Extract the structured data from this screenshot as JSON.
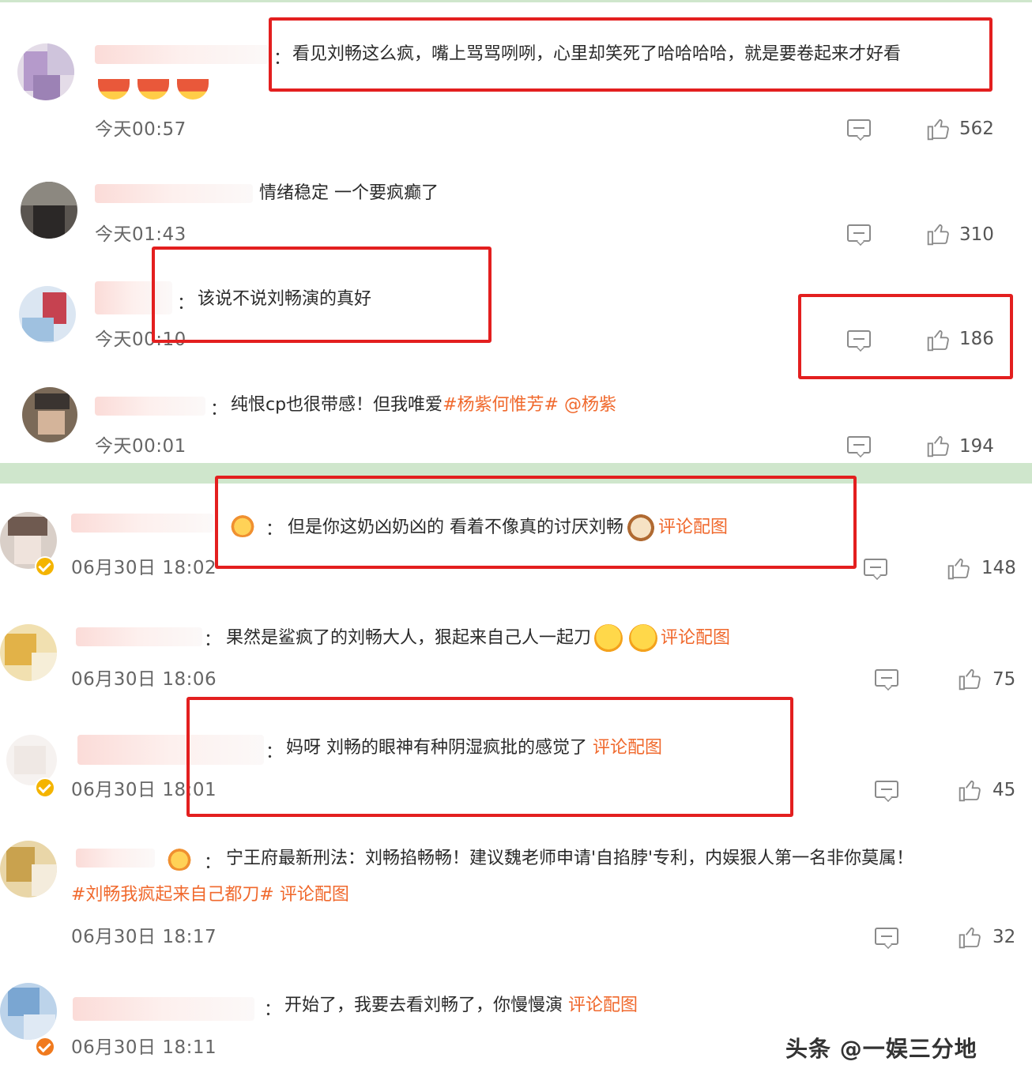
{
  "comments": [
    {
      "text": "看见刘畅这么疯，嘴上骂骂咧咧，心里却笑死了哈哈哈哈，就是要卷起来才好看",
      "time": "今天00:57",
      "likes": "562"
    },
    {
      "text": "情绪稳定 一个要疯癫了",
      "time": "今天01:43",
      "likes": "310"
    },
    {
      "text": "该说不说刘畅演的真好",
      "time": "今天00:10",
      "likes": "186"
    },
    {
      "text": "纯恨cp也很带感！但我唯爱",
      "hashtag": "#杨紫何惟芳#",
      "mention": "@杨紫",
      "time": "今天00:01",
      "likes": "194"
    },
    {
      "text": "但是你这奶凶奶凶的 看着不像真的讨厌刘畅",
      "link": "评论配图",
      "time": "06月30日 18:02",
      "likes": "148"
    },
    {
      "text": "果然是鲨疯了的刘畅大人，狠起来自己人一起刀",
      "link": "评论配图",
      "time": "06月30日 18:06",
      "likes": "75"
    },
    {
      "text": "妈呀 刘畅的眼神有种阴湿疯批的感觉了",
      "link": "评论配图",
      "time": "06月30日 18:01",
      "likes": "45"
    },
    {
      "text": "宁王府最新刑法：刘畅掐畅畅！建议魏老师申请'自掐脖'专利，内娱狠人第一名非你莫属！",
      "hashtag": "#刘畅我疯起来自己都刀#",
      "link": "评论配图",
      "time": "06月30日 18:17",
      "likes": "32"
    },
    {
      "text": "开始了，我要去看刘畅了，你慢慢演",
      "link": "评论配图",
      "time": "06月30日 18:11"
    }
  ],
  "watermark": "头条 @一娱三分地",
  "colors": {
    "highlight_box": "#e31f1f",
    "link_orange": "#f0692d",
    "divider_green": "#cfe6cc"
  },
  "icons": [
    "reply-icon",
    "thumbs-up-icon",
    "verified-badge-icon"
  ]
}
